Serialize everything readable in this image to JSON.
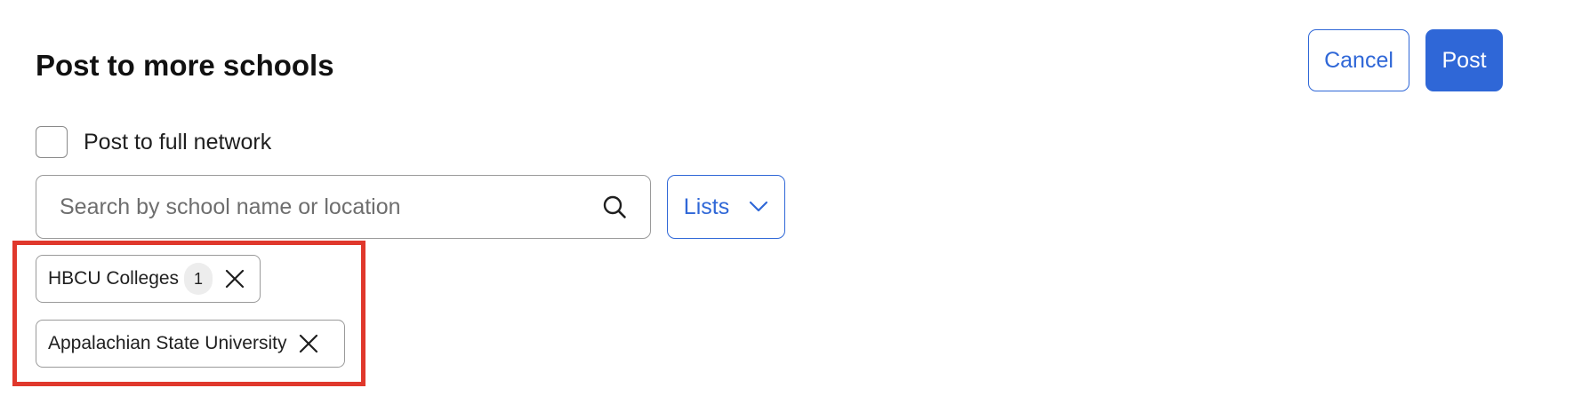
{
  "header": {
    "title": "Post to more schools",
    "cancel_label": "Cancel",
    "post_label": "Post"
  },
  "full_network": {
    "label": "Post to full network",
    "checked": false
  },
  "search": {
    "placeholder": "Search by school name or location",
    "value": "",
    "icon": "search-icon"
  },
  "lists_dropdown": {
    "label": "Lists",
    "icon": "chevron-down-icon"
  },
  "selected": [
    {
      "label": "HBCU Colleges",
      "count": "1",
      "remove_icon": "close-icon"
    },
    {
      "label": "Appalachian State University",
      "remove_icon": "close-icon"
    }
  ],
  "colors": {
    "accent": "#2f67d7",
    "highlight": "#e0382c",
    "chip_count_bg": "#ededed"
  }
}
